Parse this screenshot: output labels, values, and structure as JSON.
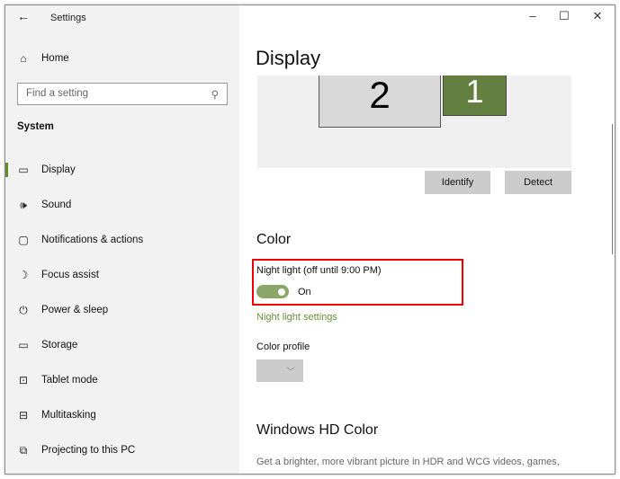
{
  "window": {
    "title": "Settings",
    "minimize": "–",
    "maximize": "☐",
    "close": "✕",
    "back": "←"
  },
  "sidebar": {
    "home": "Home",
    "search_placeholder": "Find a setting",
    "section": "System",
    "items": [
      {
        "label": "Display",
        "icon": "▭"
      },
      {
        "label": "Sound",
        "icon": "🕪"
      },
      {
        "label": "Notifications & actions",
        "icon": "▢"
      },
      {
        "label": "Focus assist",
        "icon": "☽"
      },
      {
        "label": "Power & sleep",
        "icon": "⏻"
      },
      {
        "label": "Storage",
        "icon": "▭"
      },
      {
        "label": "Tablet mode",
        "icon": "⊡"
      },
      {
        "label": "Multitasking",
        "icon": "⊟"
      },
      {
        "label": "Projecting to this PC",
        "icon": "⧉"
      }
    ]
  },
  "main": {
    "title": "Display",
    "monitor2": "2",
    "monitor1": "1",
    "identify": "Identify",
    "detect": "Detect",
    "color_heading": "Color",
    "night_light_label": "Night light (off until 9:00 PM)",
    "night_light_state": "On",
    "night_light_on": true,
    "night_light_settings": "Night light settings",
    "color_profile_label": "Color profile",
    "hd_heading": "Windows HD Color",
    "hd_desc": "Get a brighter, more vibrant picture in HDR and WCG videos, games,"
  },
  "colors": {
    "accent": "#6b8f3e",
    "highlight": "#ee0000"
  }
}
